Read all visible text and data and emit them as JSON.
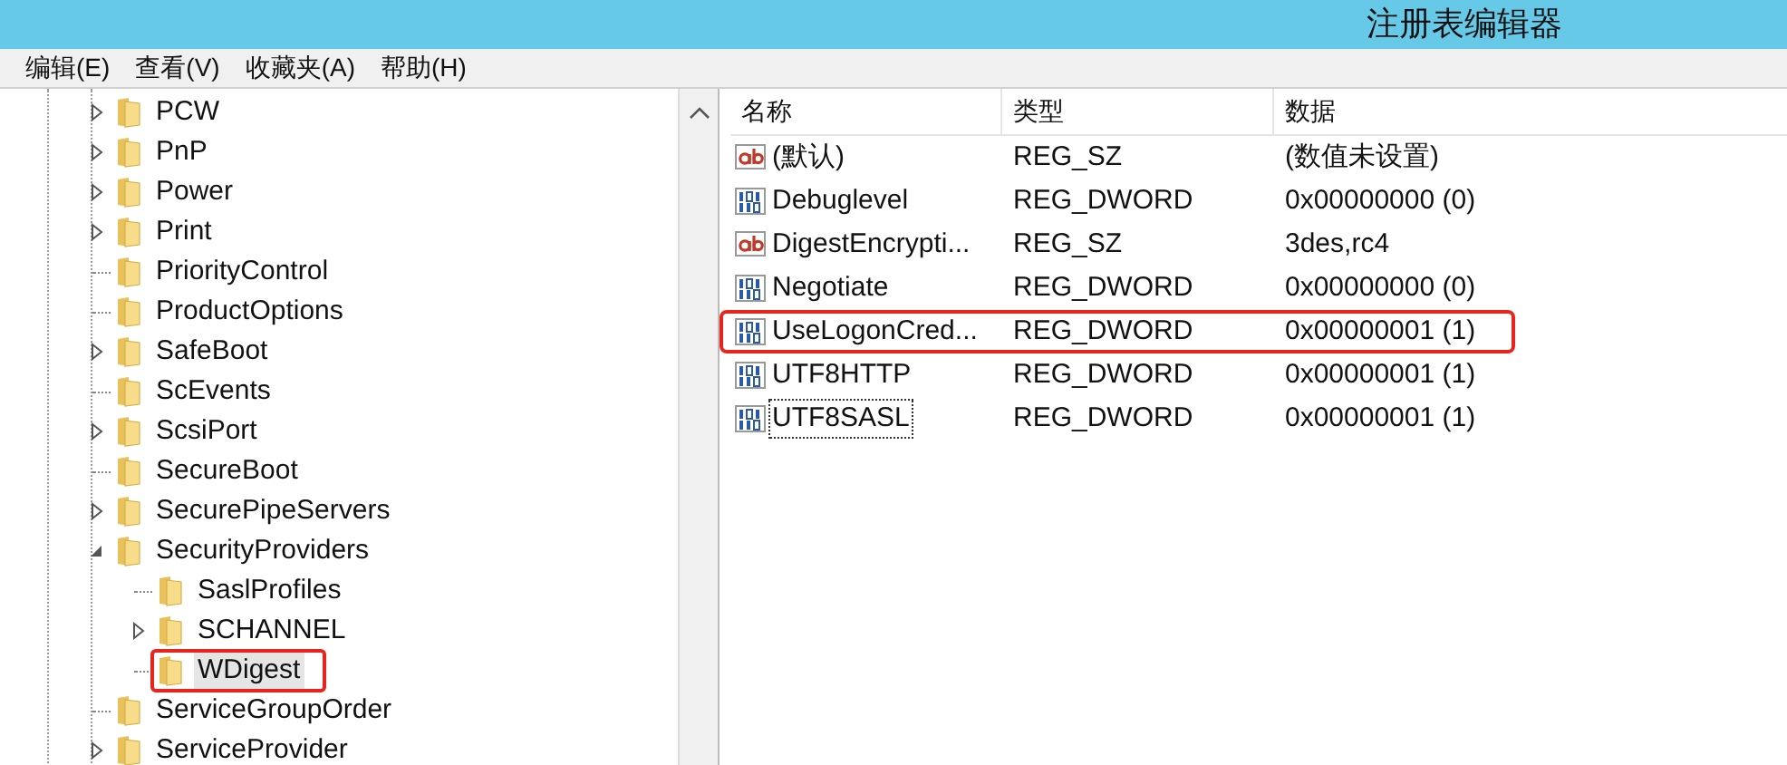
{
  "window": {
    "title": "注册表编辑器"
  },
  "menu": [
    "编辑(E)",
    "查看(V)",
    "收藏夹(A)",
    "帮助(H)"
  ],
  "tree": [
    {
      "label": "PCW",
      "kind": "collapsed",
      "selected": false,
      "highlighted": false
    },
    {
      "label": "PnP",
      "kind": "collapsed",
      "selected": false,
      "highlighted": false
    },
    {
      "label": "Power",
      "kind": "collapsed",
      "selected": false,
      "highlighted": false
    },
    {
      "label": "Print",
      "kind": "collapsed",
      "selected": false,
      "highlighted": false
    },
    {
      "label": "PriorityControl",
      "kind": "leaf",
      "selected": false,
      "highlighted": false
    },
    {
      "label": "ProductOptions",
      "kind": "leaf",
      "selected": false,
      "highlighted": false
    },
    {
      "label": "SafeBoot",
      "kind": "collapsed",
      "selected": false,
      "highlighted": false
    },
    {
      "label": "ScEvents",
      "kind": "leaf",
      "selected": false,
      "highlighted": false
    },
    {
      "label": "ScsiPort",
      "kind": "collapsed",
      "selected": false,
      "highlighted": false
    },
    {
      "label": "SecureBoot",
      "kind": "leaf",
      "selected": false,
      "highlighted": false
    },
    {
      "label": "SecurePipeServers",
      "kind": "collapsed",
      "selected": false,
      "highlighted": false
    },
    {
      "label": "SecurityProviders",
      "kind": "expanded",
      "selected": false,
      "highlighted": false,
      "children": [
        {
          "label": "SaslProfiles",
          "kind": "leaf",
          "selected": false,
          "highlighted": false
        },
        {
          "label": "SCHANNEL",
          "kind": "collapsed",
          "selected": false,
          "highlighted": false
        },
        {
          "label": "WDigest",
          "kind": "leaf",
          "selected": true,
          "highlighted": true
        }
      ]
    },
    {
      "label": "ServiceGroupOrder",
      "kind": "leaf",
      "selected": false,
      "highlighted": false
    },
    {
      "label": "ServiceProvider",
      "kind": "collapsed",
      "selected": false,
      "highlighted": false
    }
  ],
  "columns": [
    "名称",
    "类型",
    "数据"
  ],
  "values": [
    {
      "kind": "string",
      "name": "(默认)",
      "type": "REG_SZ",
      "data": "(数值未设置)",
      "highlighted": false,
      "focused": false
    },
    {
      "kind": "dword",
      "name": "Debuglevel",
      "type": "REG_DWORD",
      "data": "0x00000000 (0)",
      "highlighted": false,
      "focused": false
    },
    {
      "kind": "string",
      "name": "DigestEncrypti...",
      "type": "REG_SZ",
      "data": "3des,rc4",
      "highlighted": false,
      "focused": false
    },
    {
      "kind": "dword",
      "name": "Negotiate",
      "type": "REG_DWORD",
      "data": "0x00000000 (0)",
      "highlighted": false,
      "focused": false
    },
    {
      "kind": "dword",
      "name": "UseLogonCred...",
      "type": "REG_DWORD",
      "data": "0x00000001 (1)",
      "highlighted": true,
      "focused": false
    },
    {
      "kind": "dword",
      "name": "UTF8HTTP",
      "type": "REG_DWORD",
      "data": "0x00000001 (1)",
      "highlighted": false,
      "focused": false
    },
    {
      "kind": "dword",
      "name": "UTF8SASL",
      "type": "REG_DWORD",
      "data": "0x00000001 (1)",
      "highlighted": false,
      "focused": true
    }
  ]
}
